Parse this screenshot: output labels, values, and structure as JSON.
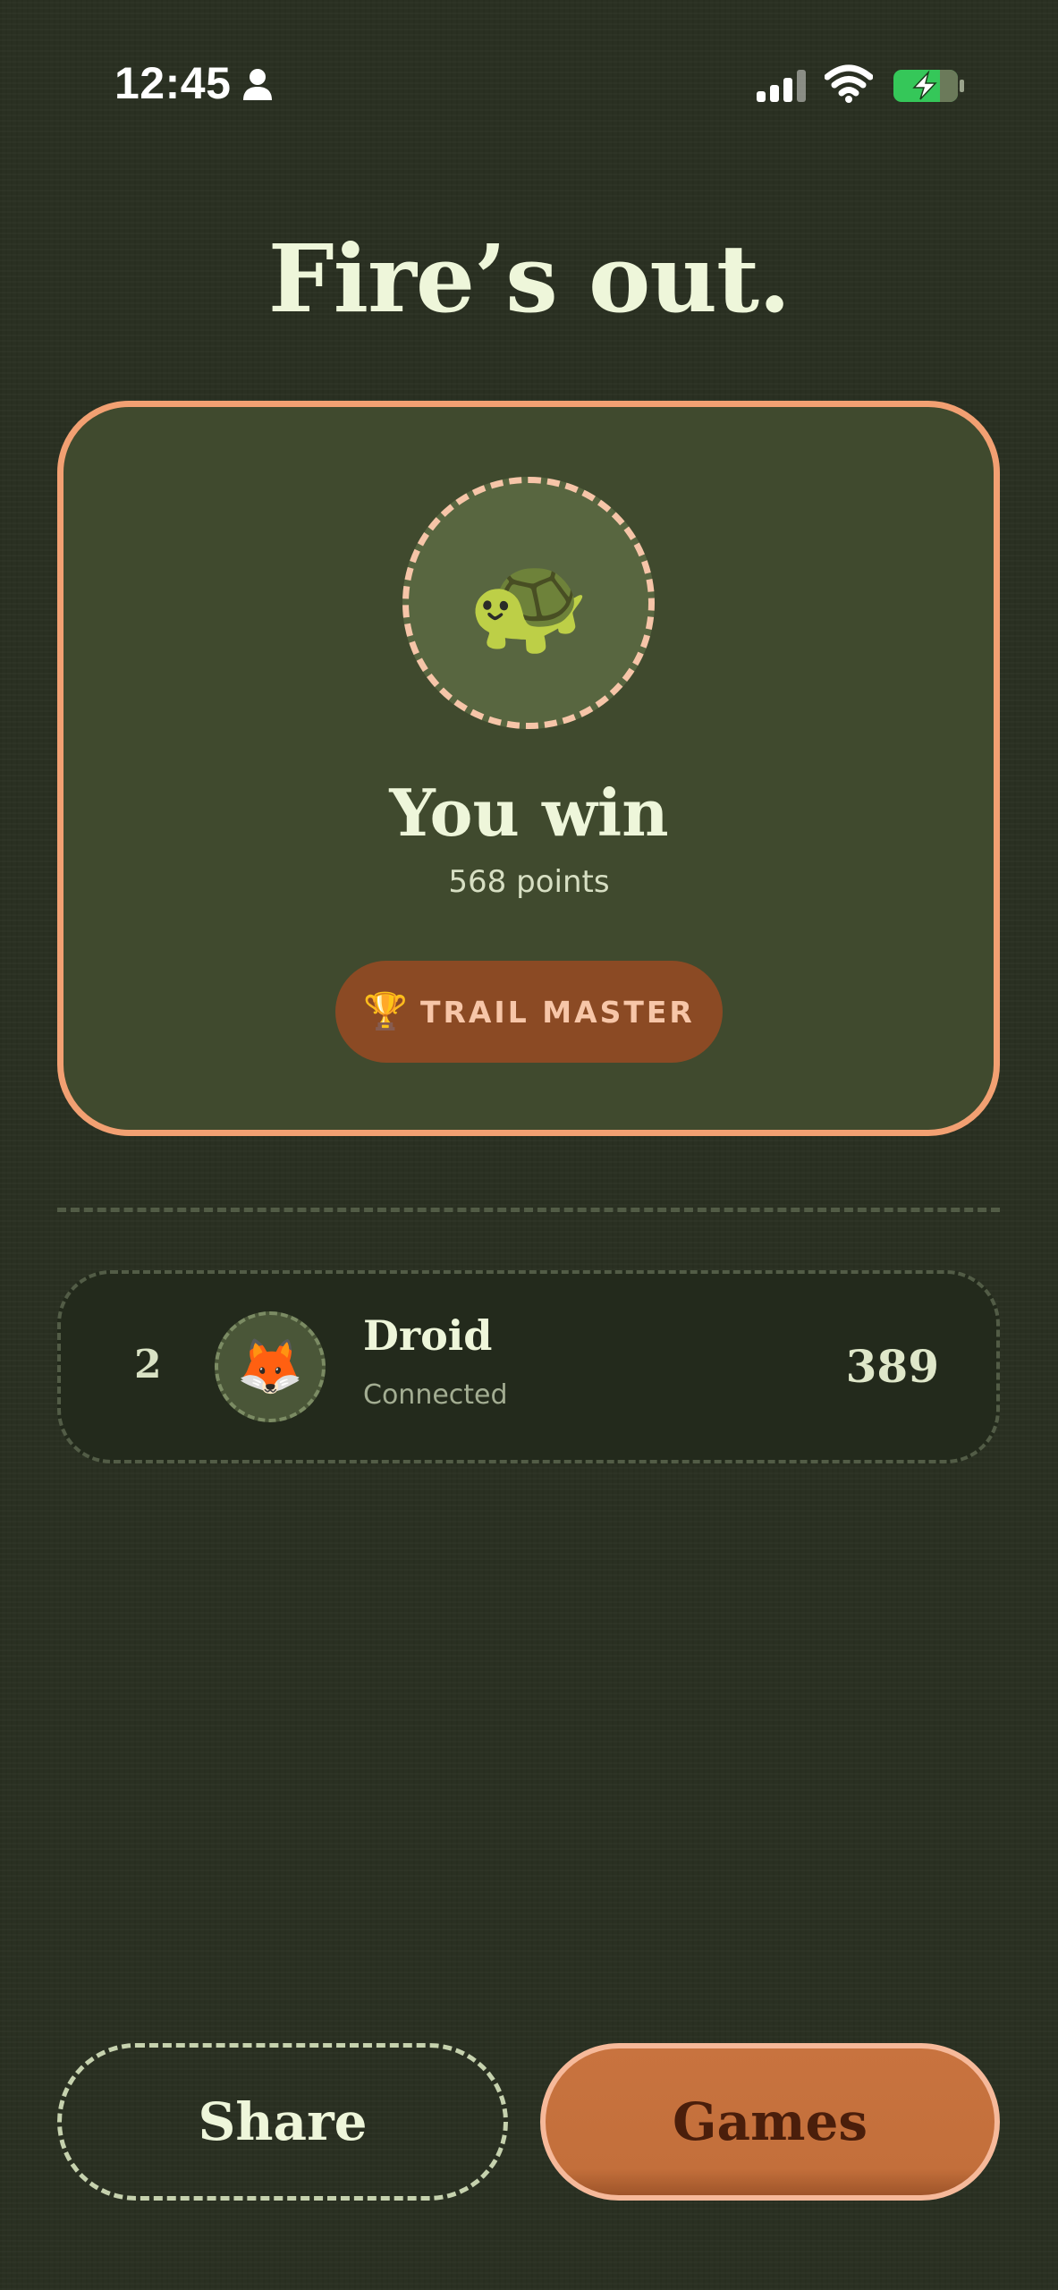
{
  "status_bar": {
    "time": "12:45",
    "icons": [
      "person-icon",
      "signal-icon",
      "wifi-icon",
      "battery-charging-icon"
    ]
  },
  "page": {
    "title": "Fire’s out."
  },
  "winner": {
    "avatar_emoji": "🐢",
    "avatar_icon": "turtle-icon",
    "title": "You win",
    "points": "568 points",
    "badge": {
      "icon": "🏆",
      "label": "TRAIL MASTER"
    }
  },
  "players": [
    {
      "rank": "2",
      "avatar_emoji": "🦊",
      "avatar_icon": "fox-icon",
      "name": "Droid",
      "status": "Connected",
      "score": "389"
    }
  ],
  "actions": {
    "share_label": "Share",
    "games_label": "Games"
  },
  "colors": {
    "background": "#2a3022",
    "card": "#404a2e",
    "accent_border": "#f2a072",
    "badge": "#8b4a24",
    "primary_button": "#c8733f",
    "text_light": "#eef6da"
  }
}
